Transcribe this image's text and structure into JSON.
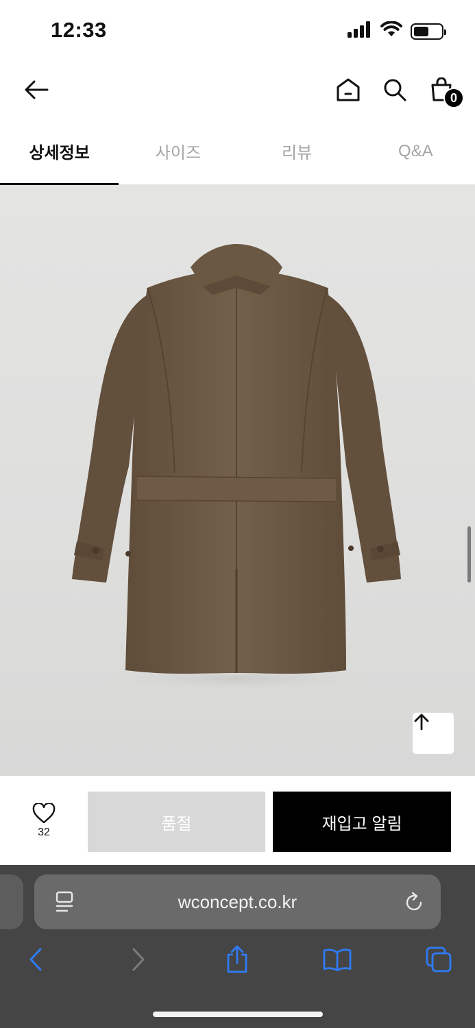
{
  "status_bar": {
    "time": "12:33",
    "icons": [
      "signal-icon",
      "wifi-icon",
      "battery-icon"
    ],
    "battery_level": 0.55
  },
  "header": {
    "icons": [
      "back-arrow-icon",
      "home-icon",
      "search-icon",
      "shopping-bag-icon"
    ],
    "cart_count": "0"
  },
  "tabs": [
    {
      "label": "상세정보",
      "active": true
    },
    {
      "label": "사이즈",
      "active": false
    },
    {
      "label": "리뷰",
      "active": false
    },
    {
      "label": "Q&A",
      "active": false
    }
  ],
  "product_image": {
    "subject": "coat-back-view",
    "background_color": "#dfdfde",
    "coat_color": "#6e5a44"
  },
  "scroll_top_icon": "arrow-up-icon",
  "purchase_bar": {
    "like_icon": "heart-icon",
    "like_count": "32",
    "soldout_label": "품절",
    "restock_label": "재입고 알림"
  },
  "browser": {
    "url": "wconcept.co.kr",
    "icons": [
      "reader-icon",
      "reload-icon",
      "chevron-left-icon",
      "chevron-right-icon",
      "share-icon",
      "bookmarks-icon",
      "tabs-icon"
    ],
    "accent_color": "#2f7bf5"
  }
}
